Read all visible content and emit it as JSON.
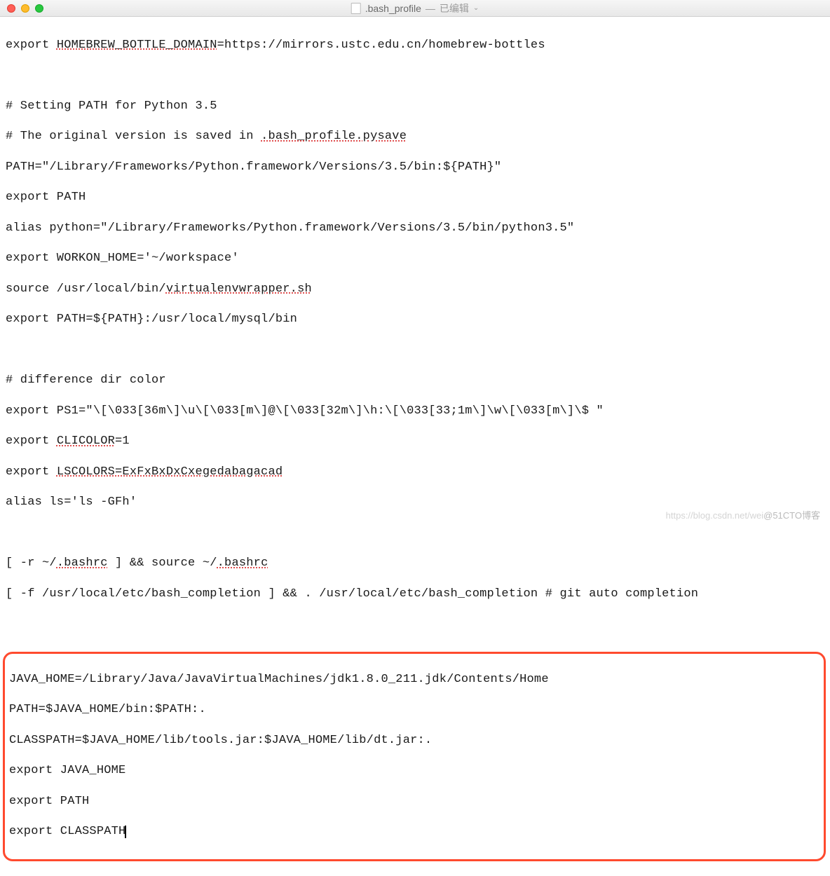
{
  "titlebar": {
    "filename": ".bash_profile",
    "separator": "—",
    "status": "已编辑"
  },
  "lines": {
    "l1a": "export ",
    "l1b": "HOMEBREW_BOTTLE_DOMAIN",
    "l1c": "=https://mirrors.ustc.edu.cn/homebrew-bottles",
    "l3": "# Setting PATH for Python 3.5",
    "l4a": "# The original version is saved in ",
    "l4b": ".bash_profile.pysave",
    "l5": "PATH=\"/Library/Frameworks/Python.framework/Versions/3.5/bin:${PATH}\"",
    "l6": "export PATH",
    "l7": "alias python=\"/Library/Frameworks/Python.framework/Versions/3.5/bin/python3.5\"",
    "l8": "export WORKON_HOME='~/workspace'",
    "l9a": "source /usr/local/bin/",
    "l9b": "virtualenvwrapper.sh",
    "l10": "export PATH=${PATH}:/usr/local/mysql/bin",
    "l12": "# difference dir color",
    "l13": "export PS1=\"\\[\\033[36m\\]\\u\\[\\033[m\\]@\\[\\033[32m\\]\\h:\\[\\033[33;1m\\]\\w\\[\\033[m\\]\\$ \"",
    "l14a": "export ",
    "l14b": "CLICOLOR",
    "l14c": "=1",
    "l15a": "export ",
    "l15b": "LSCOLORS=ExFxBxDxCxegedabagacad",
    "l16": "alias ls='ls -GFh'",
    "l18a": "[ -r ~/",
    "l18b": ".bashrc",
    "l18c": " ] && source ~/",
    "l18d": ".bashrc",
    "l19": "[ -f /usr/local/etc/bash_completion ] && . /usr/local/etc/bash_completion # git auto completion",
    "h1": "JAVA_HOME=/Library/Java/JavaVirtualMachines/jdk1.8.0_211.jdk/Contents/Home",
    "h2": "PATH=$JAVA_HOME/bin:$PATH:.",
    "h3": "CLASSPATH=$JAVA_HOME/lib/tools.jar:$JAVA_HOME/lib/dt.jar:.",
    "h4": "export JAVA_HOME",
    "h5": "export PATH",
    "h6": "export CLASSPATH"
  },
  "watermark": {
    "faint": "https://blog.csdn.net/wei",
    "text": "@51CTO博客"
  }
}
